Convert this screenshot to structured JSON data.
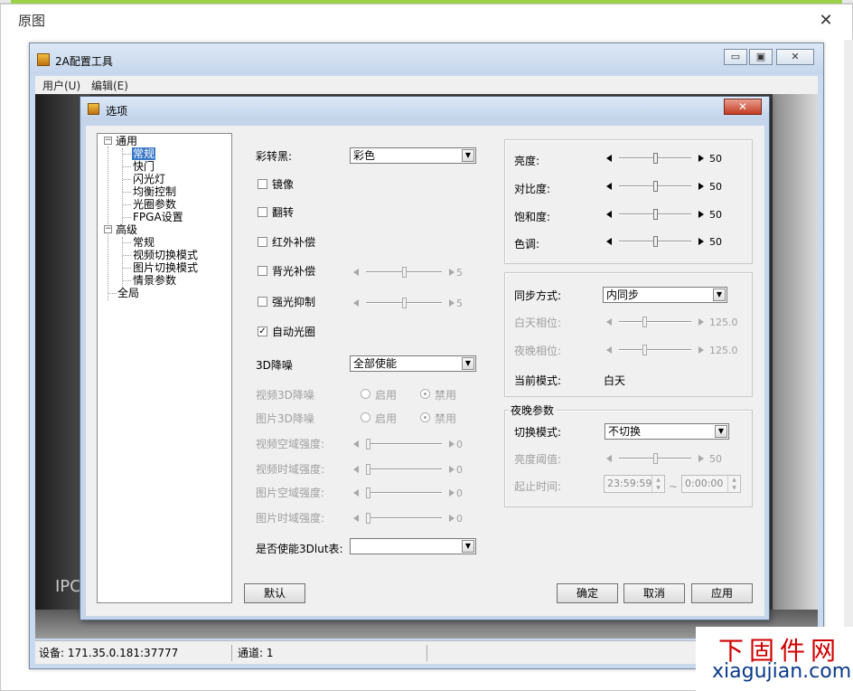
{
  "viewer": {
    "title": "原图",
    "close": "✕"
  },
  "app": {
    "title": "2A配置工具",
    "buttons": {
      "minimize": "▭",
      "restore": "▣",
      "close": "✕"
    },
    "menu": [
      "用户(U)",
      "编辑(E)"
    ],
    "overlay_text": "IPC",
    "status": {
      "device": "设备: 171.35.0.181:37777",
      "channel": "通道: 1"
    }
  },
  "dialog": {
    "title": "选项",
    "close": "✕",
    "tree": [
      {
        "label": "通用",
        "expander": "−"
      },
      {
        "label": "常规",
        "selected": true
      },
      {
        "label": "快门"
      },
      {
        "label": "闪光灯"
      },
      {
        "label": "均衡控制"
      },
      {
        "label": "光圈参数"
      },
      {
        "label": "FPGA设置"
      },
      {
        "label": "高级",
        "expander": "−"
      },
      {
        "label": "常规"
      },
      {
        "label": "视频切换模式"
      },
      {
        "label": "图片切换模式"
      },
      {
        "label": "情景参数"
      },
      {
        "label": "全局"
      }
    ],
    "left": {
      "color_to_bw": {
        "label": "彩转黑:",
        "value": "彩色"
      },
      "mirror": {
        "label": "镜像",
        "checked": false
      },
      "flip": {
        "label": "翻转",
        "checked": false
      },
      "ir_comp": {
        "label": "红外补偿",
        "checked": false
      },
      "backlight": {
        "label": "背光补偿",
        "checked": false,
        "value": "5",
        "level": 0.5
      },
      "strong_light": {
        "label": "强光抑制",
        "checked": false,
        "value": "5",
        "level": 0.5
      },
      "auto_iris": {
        "label": "自动光圈",
        "checked": true,
        "mark": "✓"
      },
      "dnr": {
        "label": "3D降噪",
        "value": "全部使能"
      },
      "video_3d": {
        "label": "视频3D降噪",
        "enable": "启用",
        "disable": "禁用",
        "selected": "禁用"
      },
      "image_3d": {
        "label": "图片3D降噪",
        "enable": "启用",
        "disable": "禁用",
        "selected": "禁用"
      },
      "video_spatial": {
        "label": "视频空域强度:",
        "value": "0",
        "level": 0
      },
      "video_temporal": {
        "label": "视频时域强度:",
        "value": "0",
        "level": 0
      },
      "image_spatial": {
        "label": "图片空域强度:",
        "value": "0",
        "level": 0
      },
      "image_temporal": {
        "label": "图片时域强度:",
        "value": "0",
        "level": 0
      },
      "lut3d": {
        "label": "是否使能3Dlut表:",
        "value": ""
      }
    },
    "image": {
      "brightness": {
        "label": "亮度:",
        "value": "50",
        "level": 0.5
      },
      "contrast": {
        "label": "对比度:",
        "value": "50",
        "level": 0.5
      },
      "saturation": {
        "label": "饱和度:",
        "value": "50",
        "level": 0.5
      },
      "hue": {
        "label": "色调:",
        "value": "50",
        "level": 0.5
      }
    },
    "sync": {
      "mode": {
        "label": "同步方式:",
        "value": "内同步"
      },
      "day_phase": {
        "label": "白天相位:",
        "value": "125.0",
        "level": 0.35
      },
      "night_phase": {
        "label": "夜晚相位:",
        "value": "125.0",
        "level": 0.35
      },
      "current": {
        "label": "当前模式:",
        "value": "白天"
      }
    },
    "night": {
      "title": "夜晚参数",
      "switch_mode": {
        "label": "切换模式:",
        "value": "不切换"
      },
      "threshold": {
        "label": "亮度阈值:",
        "value": "50",
        "level": 0.5
      },
      "period": {
        "label": "起止时间:",
        "start": "23:59:59",
        "sep": "~",
        "end": "0:00:00"
      }
    },
    "buttons": {
      "default": "默认",
      "ok": "确定",
      "cancel": "取消",
      "apply": "应用"
    }
  },
  "watermark": {
    "cn": "下固件网",
    "en": "xiagujian.com"
  }
}
